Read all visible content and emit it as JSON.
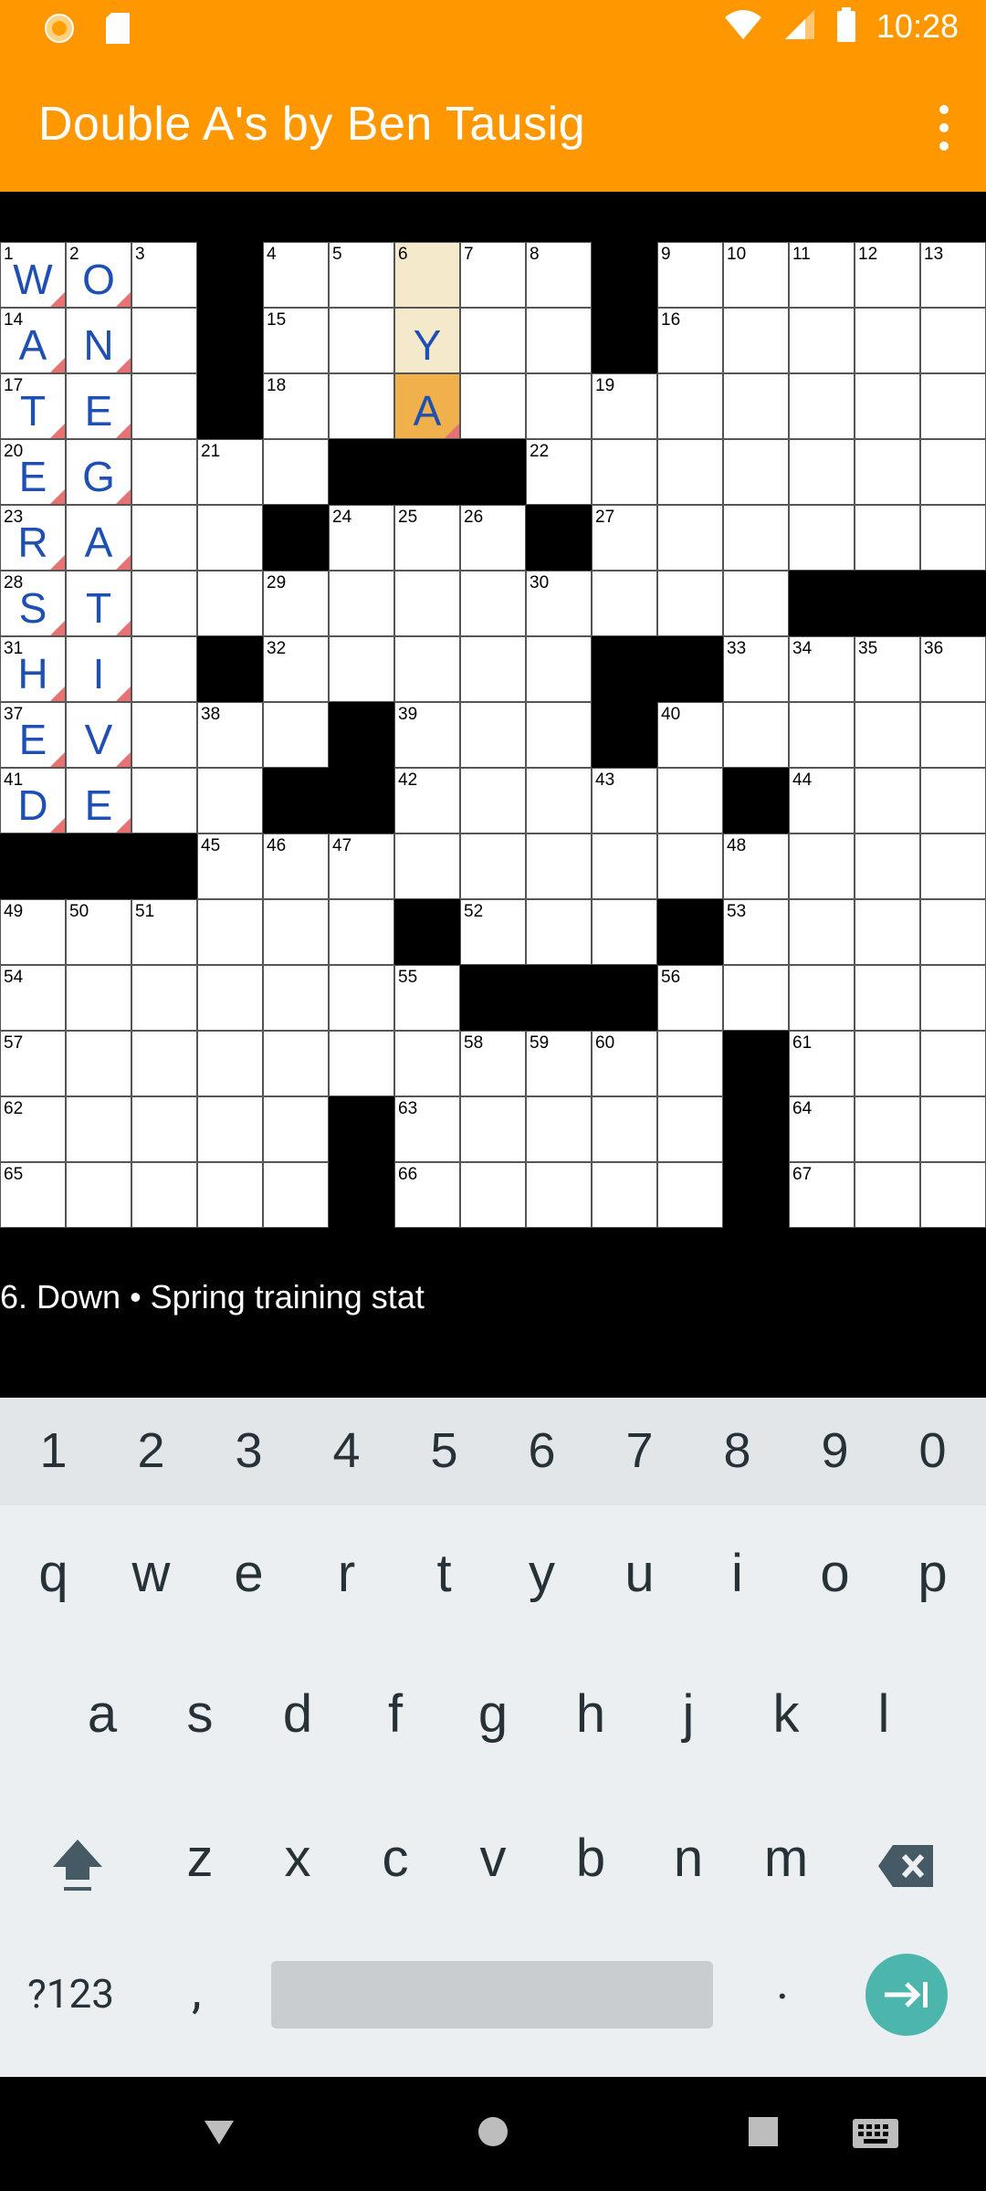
{
  "status_bar": {
    "time": "10:28",
    "icons": [
      "sun-notification-icon",
      "sd-card-icon",
      "wifi-icon",
      "signal-icon",
      "battery-icon"
    ]
  },
  "app_bar": {
    "title": "Double A's by Ben Tausig"
  },
  "grid": {
    "size": 15,
    "blacks": [
      "0,3",
      "1,3",
      "2,3",
      "3,5",
      "3,6",
      "3,7",
      "4,4",
      "4,8",
      "5,12",
      "5,13",
      "5,14",
      "6,3",
      "6,9",
      "6,10",
      "7,5",
      "7,9",
      "8,4",
      "8,5",
      "8,11",
      "9,0",
      "9,1",
      "9,2",
      "10,6",
      "10,10",
      "11,7",
      "11,8",
      "11,9",
      "12,11",
      "13,5",
      "13,11",
      "14,5",
      "14,11",
      "1,9",
      "0,9"
    ],
    "numbers": {
      "0,0": "1",
      "0,1": "2",
      "0,2": "3",
      "0,4": "4",
      "0,5": "5",
      "0,6": "6",
      "0,7": "7",
      "0,8": "8",
      "0,10": "9",
      "0,11": "10",
      "0,12": "11",
      "0,13": "12",
      "0,14": "13",
      "1,0": "14",
      "1,4": "15",
      "1,10": "16",
      "2,0": "17",
      "2,4": "18",
      "2,9": "19",
      "3,0": "20",
      "3,3": "21",
      "3,8": "22",
      "4,0": "23",
      "4,5": "24",
      "4,6": "25",
      "4,7": "26",
      "4,9": "27",
      "5,0": "28",
      "5,4": "29",
      "5,8": "30",
      "6,0": "31",
      "6,4": "32",
      "6,11": "33",
      "6,12": "34",
      "6,13": "35",
      "6,14": "36",
      "7,0": "37",
      "7,3": "38",
      "7,6": "39",
      "7,10": "40",
      "8,0": "41",
      "8,6": "42",
      "8,9": "43",
      "8,12": "44",
      "9,3": "45",
      "9,4": "46",
      "9,5": "47",
      "9,11": "48",
      "10,0": "49",
      "10,1": "50",
      "10,2": "51",
      "10,7": "52",
      "10,11": "53",
      "11,0": "54",
      "11,6": "55",
      "11,10": "56",
      "12,0": "57",
      "12,7": "58",
      "12,8": "59",
      "12,9": "60",
      "12,12": "61",
      "13,0": "62",
      "13,6": "63",
      "13,12": "64",
      "14,0": "65",
      "14,6": "66",
      "14,12": "67"
    },
    "letters": {
      "0,0": "W",
      "1,0": "A",
      "2,0": "T",
      "3,0": "E",
      "4,0": "R",
      "5,0": "S",
      "6,0": "H",
      "7,0": "E",
      "8,0": "D",
      "0,1": "O",
      "1,1": "N",
      "2,1": "E",
      "3,1": "G",
      "4,1": "A",
      "5,1": "T",
      "6,1": "I",
      "7,1": "V",
      "8,1": "E",
      "1,6": "Y",
      "2,6": "A"
    },
    "flagged": [
      "0,0",
      "1,0",
      "2,0",
      "3,0",
      "4,0",
      "5,0",
      "6,0",
      "7,0",
      "8,0",
      "0,1",
      "1,1",
      "2,1",
      "3,1",
      "4,1",
      "5,1",
      "6,1",
      "7,1",
      "8,1",
      "2,6"
    ],
    "word_highlight": [
      "0,6",
      "1,6"
    ],
    "selected": "2,6"
  },
  "clue": {
    "text": "6. Down • Spring training stat"
  },
  "keyboard": {
    "number_row": [
      "1",
      "2",
      "3",
      "4",
      "5",
      "6",
      "7",
      "8",
      "9",
      "0"
    ],
    "row1": [
      "q",
      "w",
      "e",
      "r",
      "t",
      "y",
      "u",
      "i",
      "o",
      "p"
    ],
    "row2": [
      "a",
      "s",
      "d",
      "f",
      "g",
      "h",
      "j",
      "k",
      "l"
    ],
    "row3": [
      "z",
      "x",
      "c",
      "v",
      "b",
      "n",
      "m"
    ],
    "symbols_label": "?123",
    "comma_label": ",",
    "period_label": "."
  },
  "colors": {
    "accent": "#FF9800",
    "letter": "#1E4FB2",
    "selected_cell": "#F0B04C",
    "word_highlight": "#F5E9CC",
    "flag": "#E57373",
    "enter_key": "#4DB6AC"
  }
}
